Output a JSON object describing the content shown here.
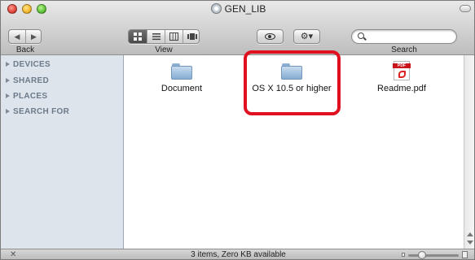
{
  "window": {
    "title": "GEN_LIB"
  },
  "toolbar": {
    "back_label": "Back",
    "view_label": "View",
    "search_label": "Search",
    "back_icon": "◀",
    "forward_icon": "▶",
    "search_value": "",
    "search_placeholder": ""
  },
  "sidebar": {
    "sections": [
      {
        "label": "DEVICES"
      },
      {
        "label": "SHARED"
      },
      {
        "label": "PLACES"
      },
      {
        "label": "SEARCH FOR"
      }
    ]
  },
  "content": {
    "items": [
      {
        "name": "Document",
        "icon": "folder-icon"
      },
      {
        "name": "OS X 10.5 or higher",
        "icon": "folder-icon"
      },
      {
        "name": "Readme.pdf",
        "icon": "pdf-file-icon",
        "badge": "PDF"
      }
    ],
    "highlight_color": "#e01020"
  },
  "status": {
    "text": "3 items, Zero KB available"
  }
}
